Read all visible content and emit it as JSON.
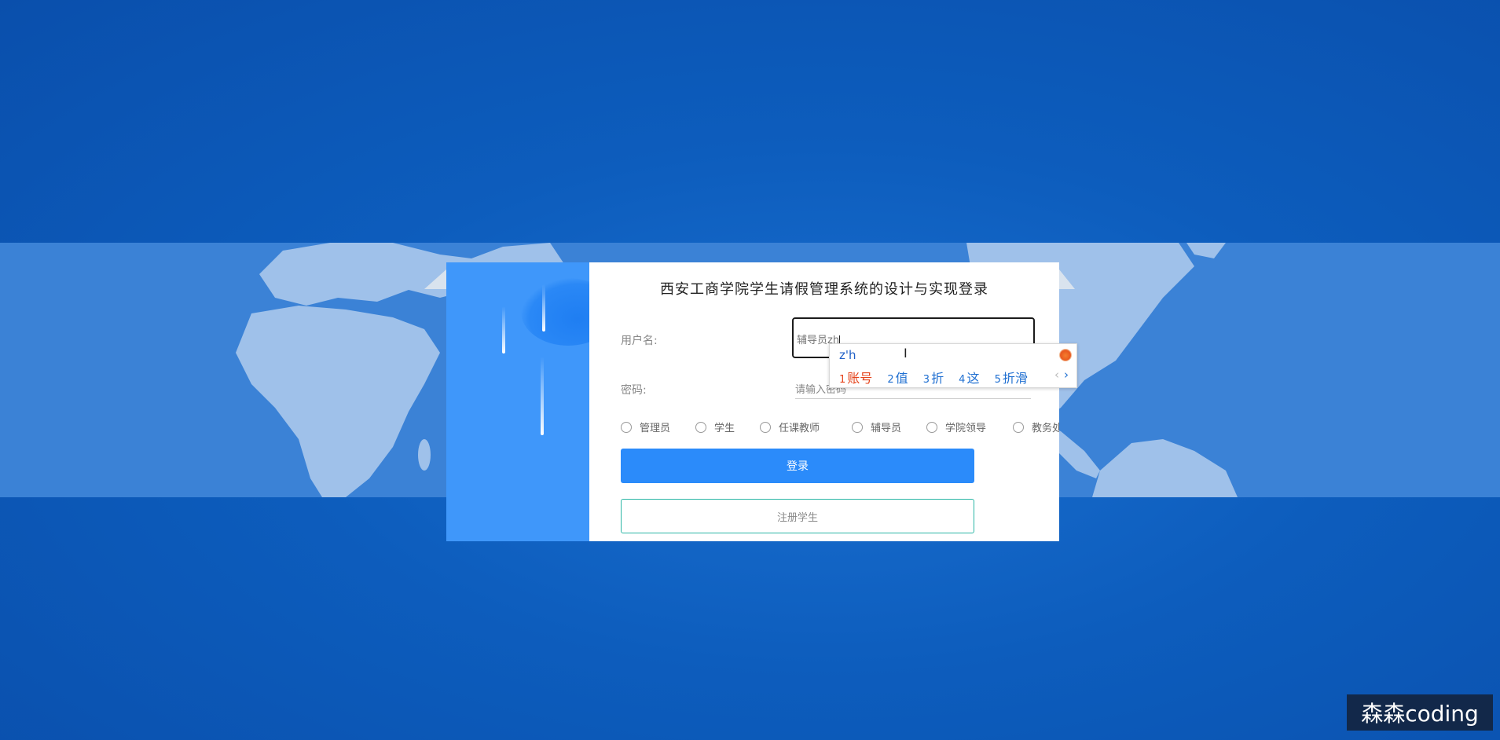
{
  "colors": {
    "background": "#0d5dbd",
    "map_band": "#3b82d6",
    "accent_blue": "#2b8bfa",
    "register_border": "#2bb6a5",
    "ime_active": "#e5431b"
  },
  "login": {
    "title": "西安工商学院学生请假管理系统的设计与实现登录",
    "username_label": "用户名:",
    "username_value": "辅导员zh",
    "password_label": "密码:",
    "password_placeholder": "请输入密码",
    "roles": [
      "管理员",
      "学生",
      "任课教师",
      "辅导员",
      "学院领导",
      "教务处"
    ],
    "login_button": "登录",
    "register_button": "注册学生"
  },
  "ime": {
    "input": "z'h",
    "candidates": [
      {
        "num": "1",
        "text": "账号"
      },
      {
        "num": "2",
        "text": "值"
      },
      {
        "num": "3",
        "text": "折"
      },
      {
        "num": "4",
        "text": "这"
      },
      {
        "num": "5",
        "text": "折滑"
      }
    ],
    "prev": "‹",
    "next": "›",
    "logo_icon": "sogou-ime-icon"
  },
  "watermark": "森森coding"
}
